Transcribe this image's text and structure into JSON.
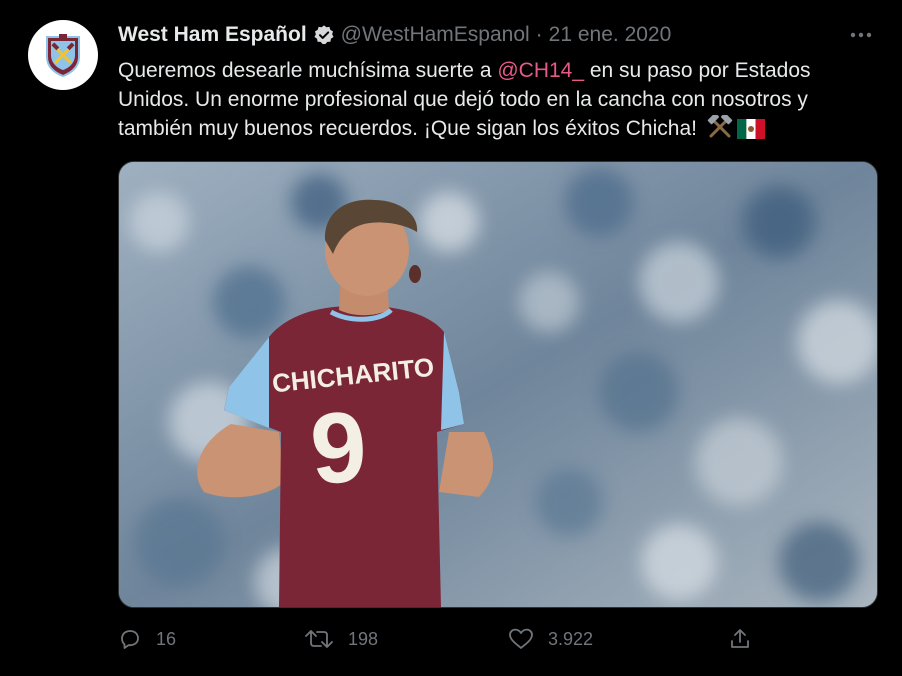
{
  "tweet": {
    "author_name": "West Ham Español",
    "handle": "@WestHamEspanol",
    "separator": "·",
    "date": "21 ene. 2020",
    "text_before": "Queremos desearle muchísima suerte a ",
    "mention": "@CH14_",
    "text_after": " en su paso por Estados Unidos. Un enorme profesional que dejó todo en la cancha con nosotros y también muy buenos recuerdos. ¡Que sigan los éxitos Chicha!",
    "emojis": [
      "hammers-emoji",
      "mexico-flag-emoji"
    ],
    "image": {
      "jersey_name": "CHICHARITO",
      "jersey_number": "9"
    }
  },
  "actions": {
    "replies": "16",
    "retweets": "198",
    "likes": "3.922"
  },
  "colors": {
    "background": "#000000",
    "text": "#e7e9ea",
    "muted": "#71767b",
    "mention": "#e8598b",
    "claret": "#7a2637",
    "sky_blue": "#8fc3e8"
  },
  "icons": [
    "west-ham-crest-icon",
    "verified-badge-icon",
    "more-icon",
    "reply-icon",
    "retweet-icon",
    "like-icon",
    "share-icon"
  ]
}
